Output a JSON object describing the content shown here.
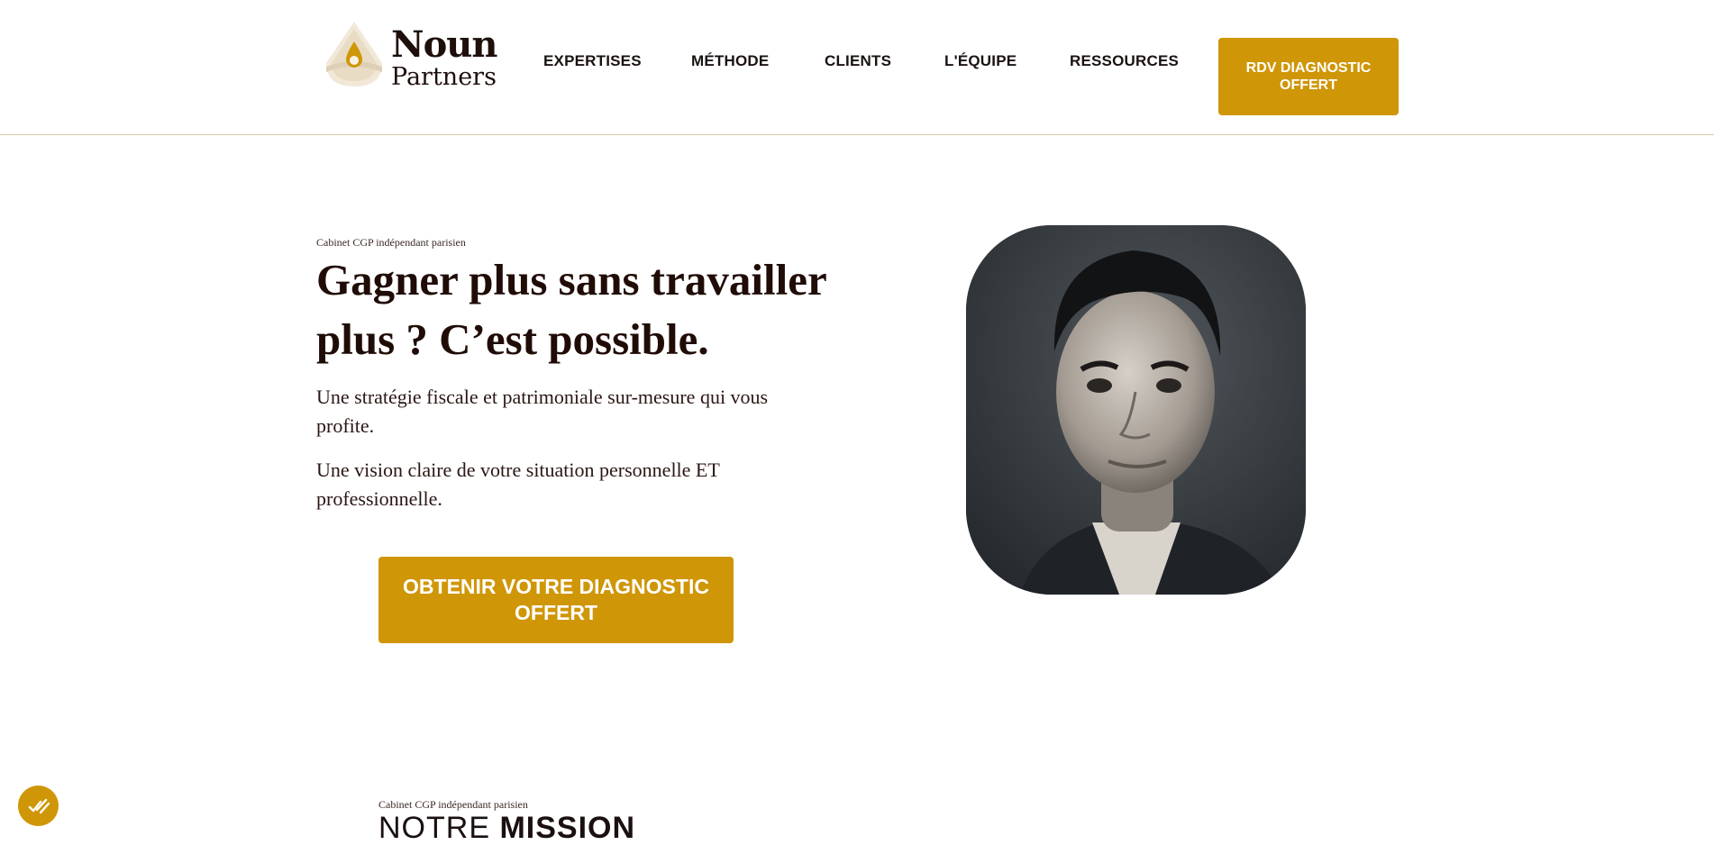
{
  "brand": {
    "line1": "Noun",
    "line2": "Partners"
  },
  "nav": {
    "items": [
      "EXPERTISES",
      "MÉTHODE",
      "CLIENTS",
      "L'ÉQUIPE",
      "RESSOURCES"
    ],
    "cta": "RDV DIAGNOSTIC OFFERT"
  },
  "hero": {
    "kicker": "Cabinet CGP indépendant parisien",
    "title": "Gagner plus sans travailler plus ? C’est possible.",
    "paragraphs": [
      "Une stratégie fiscale et patrimoniale sur-mesure qui vous profite.",
      "Une vision claire de votre situation personnelle ET professionnelle."
    ],
    "cta": "OBTENIR VOTRE DIAGNOSTIC OFFERT"
  },
  "mission": {
    "kicker": "Cabinet CGP indépendant parisien",
    "title_light": "NOTRE ",
    "title_bold": "MISSION"
  },
  "colors": {
    "accent": "#CF9607",
    "text": "#200C07",
    "divider": "#D9C9A8"
  },
  "icons": {
    "logo": "drop-logo-icon",
    "cookie": "cookie-consent-icon"
  }
}
